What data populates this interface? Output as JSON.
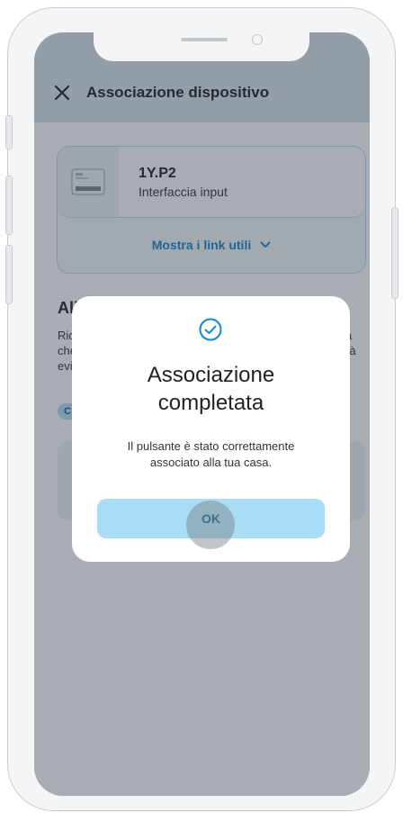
{
  "header": {
    "title": "Associazione dispositivo",
    "close_icon": "close-icon"
  },
  "device": {
    "name": "1Y.P2",
    "type": "Interfaccia input",
    "links_label": "Mostra i link utili",
    "links_icon": "chevron-down-icon"
  },
  "background": {
    "section_title_fragment": "Ali",
    "para_left_lines": [
      "Ric",
      "che",
      "evi"
    ],
    "para_right_lines": [
      "a",
      "rà"
    ],
    "chip_fragment": "C"
  },
  "modal": {
    "icon": "check-circle-icon",
    "title": "Associazione\ncompletata",
    "message": "Il pulsante è stato correttamente\nassociato alla tua casa.",
    "ok_label": "OK"
  },
  "colors": {
    "accent": "#1486c9",
    "ok_button_bg": "#a9dcf5",
    "header_bg": "#dde6ee"
  }
}
